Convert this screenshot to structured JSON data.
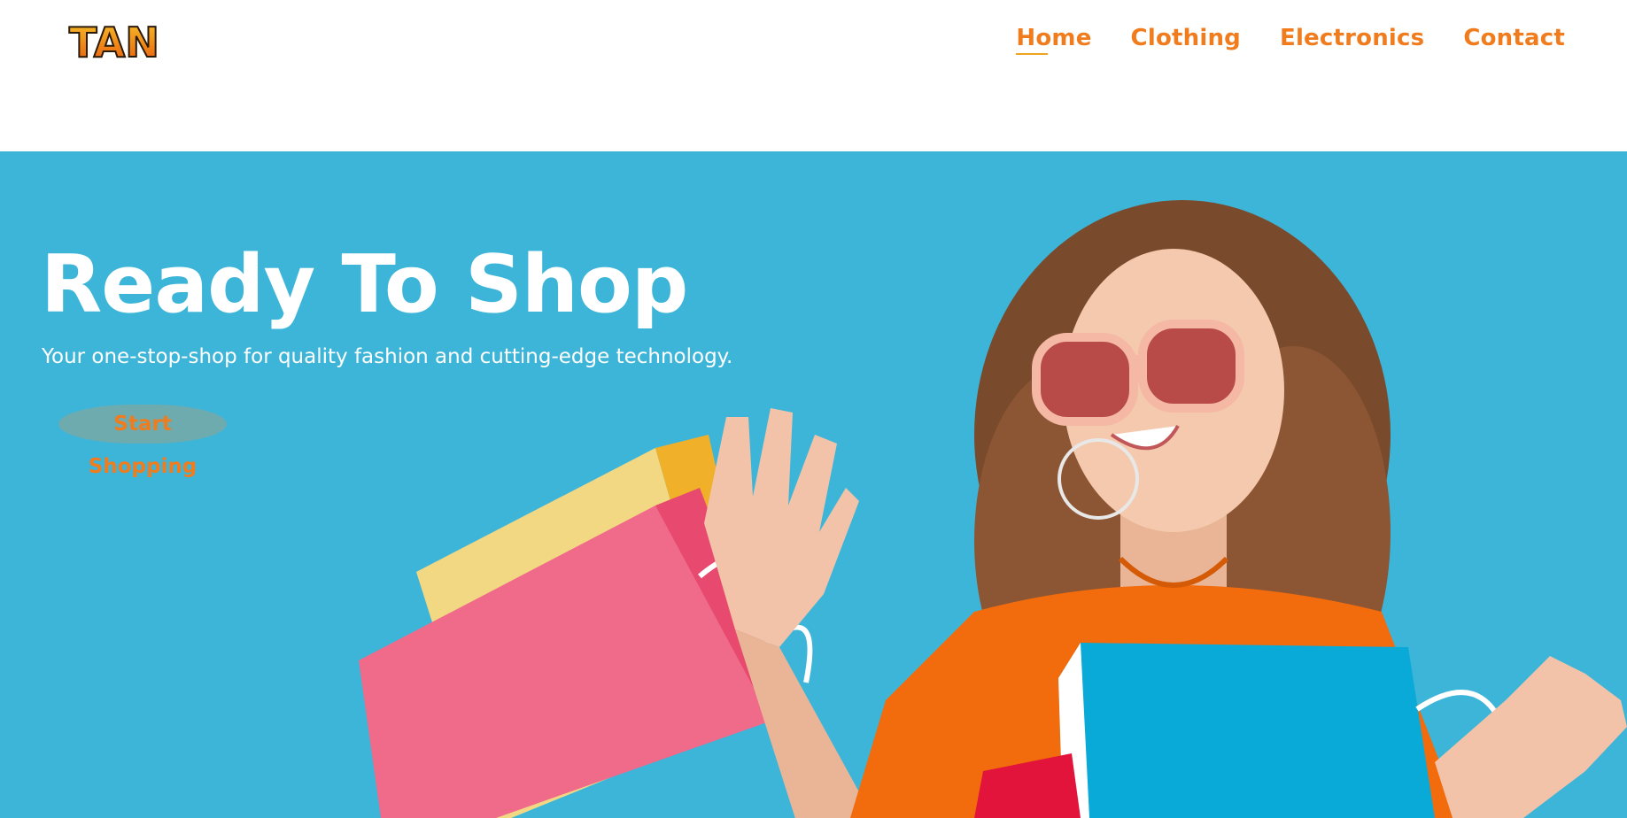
{
  "brand": {
    "logo_text": "TAN"
  },
  "nav": {
    "items": [
      {
        "label": "Home"
      },
      {
        "label": "Clothing"
      },
      {
        "label": "Electronics"
      },
      {
        "label": "Contact"
      }
    ]
  },
  "hero": {
    "title": "Ready To Shop",
    "subtitle": "Your one-stop-shop for quality fashion and cutting-edge technology.",
    "cta_label": "Start Shopping"
  },
  "colors": {
    "accent": "#f07c1e",
    "hero_background": "#3db5d9",
    "header_background": "#ffffff"
  }
}
